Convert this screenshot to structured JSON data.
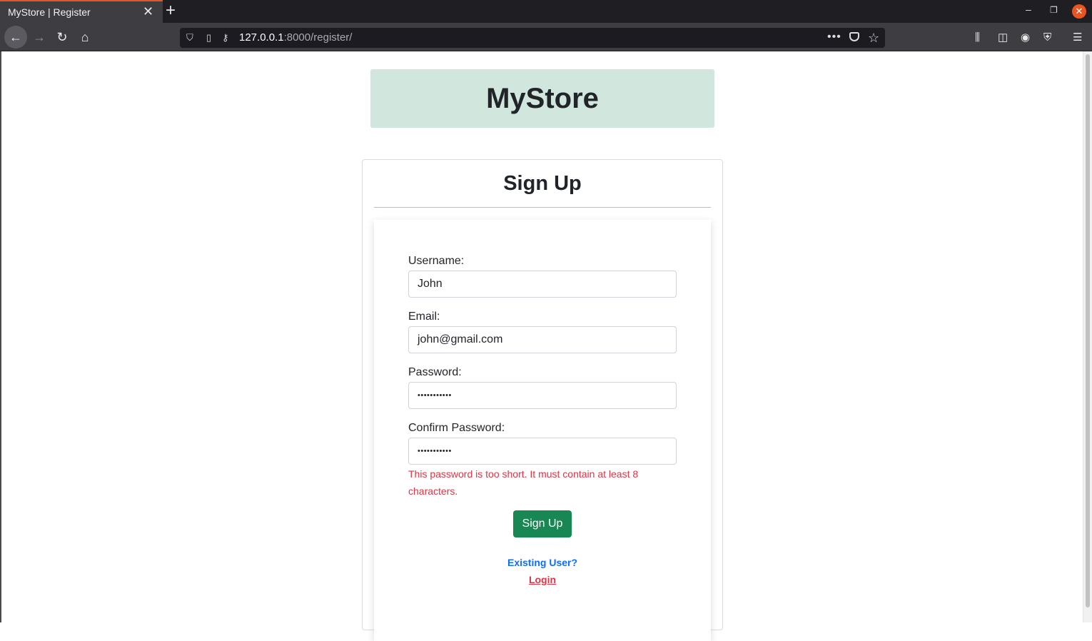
{
  "browser": {
    "tab_title": "MyStore | Register",
    "url_host": "127.0.0.1",
    "url_rest": ":8000/register/"
  },
  "header": {
    "brand": "MyStore"
  },
  "card": {
    "title": "Sign Up"
  },
  "form": {
    "username_label": "Username:",
    "username_value": "John",
    "email_label": "Email:",
    "email_value": "john@gmail.com",
    "password_label": "Password:",
    "password_masked": "•••••••••••",
    "confirm_label": "Confirm Password:",
    "confirm_masked": "•••••••••••",
    "error_message": "This password is too short. It must contain at least 8 characters.",
    "submit_label": "Sign Up"
  },
  "footer": {
    "existing_user": "Existing User?",
    "login_label": "Login"
  },
  "colors": {
    "brand_bg": "#d1e7dd",
    "button_green": "#198754",
    "error_red": "#dc3545",
    "link_blue": "#0d6efd"
  }
}
